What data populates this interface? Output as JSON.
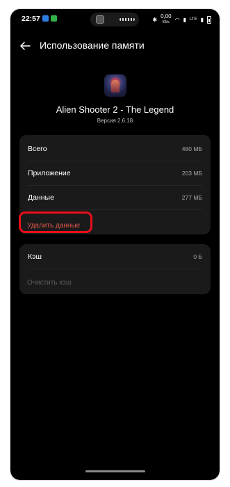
{
  "status_bar": {
    "time": "22:57",
    "network_speed": "0,00",
    "network_unit": "КБ/с",
    "lte_label": "LTE"
  },
  "header": {
    "title": "Использование памяти"
  },
  "app": {
    "name": "Alien Shooter 2 - The Legend",
    "version": "Версия 2.6.18"
  },
  "storage": {
    "rows": [
      {
        "label": "Всего",
        "value": "480 МБ"
      },
      {
        "label": "Приложение",
        "value": "203 МБ"
      },
      {
        "label": "Данные",
        "value": "277 МБ"
      }
    ],
    "delete_label": "Удалить данные"
  },
  "cache": {
    "label": "Кэш",
    "value": "0 Б",
    "clear_label": "Очистить кэш"
  },
  "colors": {
    "background": "#000000",
    "card": "#1a1a1a",
    "destructive": "#e0574f",
    "highlight": "#e8101b"
  }
}
